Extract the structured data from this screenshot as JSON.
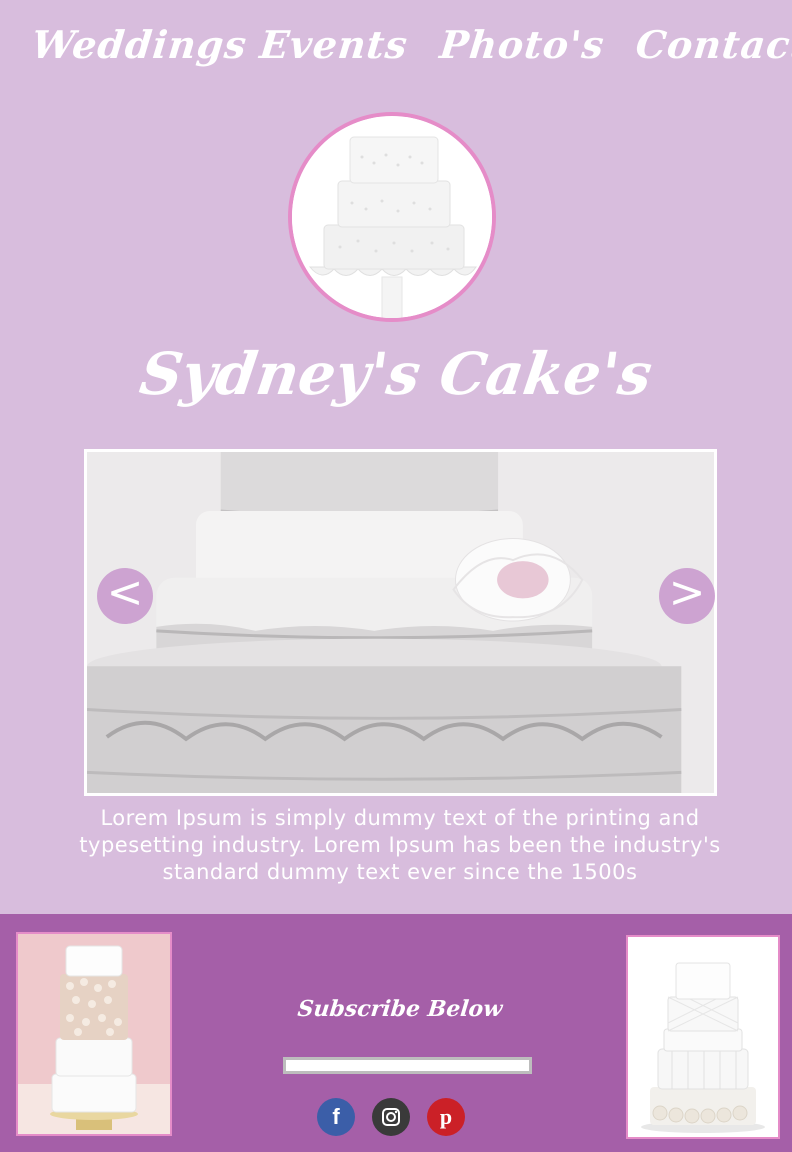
{
  "nav": {
    "items": [
      {
        "label": "Weddings"
      },
      {
        "label": "Events"
      },
      {
        "label": "Photo's"
      },
      {
        "label": "Contact"
      }
    ]
  },
  "brand": {
    "title": "Sydney's Cake's"
  },
  "slider": {
    "prev_label": "<",
    "next_label": ">"
  },
  "intro": {
    "text": "Lorem Ipsum is simply dummy text of the printing and typesetting industry. Lorem Ipsum has been the industry's standard dummy text ever since the 1500s"
  },
  "footer": {
    "subscribe_title": "Subscribe Below",
    "subscribe_value": "",
    "social": [
      {
        "icon": "facebook-icon",
        "glyph": "f",
        "color": "#3b5ea8"
      },
      {
        "icon": "instagram-icon",
        "glyph": "",
        "color": "#3a3a3a"
      },
      {
        "icon": "pinterest-icon",
        "glyph": "p",
        "color": "#cb2027"
      }
    ]
  },
  "colors": {
    "page_background": "#d8bddd",
    "footer_background": "#a55fa8",
    "accent_border": "#e58cc8",
    "text": "#ffffff"
  }
}
